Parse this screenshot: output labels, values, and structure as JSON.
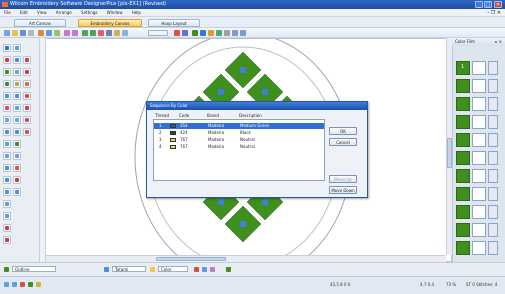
{
  "window": {
    "title": "Wilcom Embroidery Software DesignerPlus   [pix-EX1]    (Revised)",
    "buttons": [
      "_",
      "□",
      "✕"
    ]
  },
  "menubar": {
    "items": [
      "File",
      "Edit",
      "View",
      "Arrange",
      "Settings",
      "Window",
      "Help"
    ],
    "mdi_controls": "- ❐ ✕"
  },
  "tabs": [
    {
      "label": "Art Canvas",
      "active": false
    },
    {
      "label": "Embroidery Canvas",
      "active": true
    },
    {
      "label": "Hoop Layout",
      "active": false
    }
  ],
  "right_panel": {
    "title": "Color Film",
    "pin": "▸ ✕",
    "swatch_label": "1"
  },
  "dialog": {
    "title": "Sequence By Color",
    "columns": [
      "Thread",
      "Code",
      "Brand",
      "Description"
    ],
    "rows": [
      {
        "num": "1",
        "swatch": "#1f5fc4",
        "code": "354",
        "brand": "Madeira",
        "desc": "Medium Green",
        "selected": true
      },
      {
        "num": "2",
        "swatch": "#3b3b3b",
        "code": "424",
        "brand": "Madeira",
        "desc": "Black",
        "selected": false
      },
      {
        "num": "3",
        "swatch": "#f2d84a",
        "code": "767",
        "brand": "Madeira",
        "desc": "Neutral",
        "selected": false
      },
      {
        "num": "4",
        "swatch": "#f2d84a",
        "code": "767",
        "brand": "Madeira",
        "desc": "Neutral",
        "selected": false
      }
    ],
    "buttons": {
      "ok": "OK",
      "cancel": "Cancel",
      "move_up": "Move Up",
      "move_down": "Move Down"
    }
  },
  "status": {
    "outline_label": "Outline",
    "fill_label": "Tatami",
    "color_label": "Color",
    "stitch_count": "43,5 8 0 0",
    "coords": "4.7 0.4",
    "zoom": "73 %",
    "stitches_label": "ST 0 Stitches: 4"
  },
  "colors": {
    "accent": "#2f6fd6",
    "embroidery_green": "#3f8f1e",
    "embroidery_blue": "#3f7fd8"
  }
}
